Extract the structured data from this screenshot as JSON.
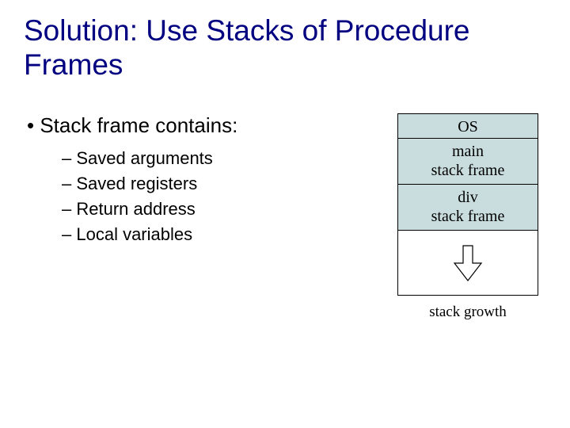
{
  "title": "Solution: Use Stacks of Procedure Frames",
  "bullet": {
    "main": "Stack frame contains:",
    "items": [
      "Saved arguments",
      "Saved registers",
      "Return address",
      "Local variables"
    ]
  },
  "stack": {
    "os": "OS",
    "frame1_line1": "main",
    "frame1_line2": "stack frame",
    "frame2_line1": "div",
    "frame2_line2": "stack frame",
    "growth": "stack growth"
  }
}
